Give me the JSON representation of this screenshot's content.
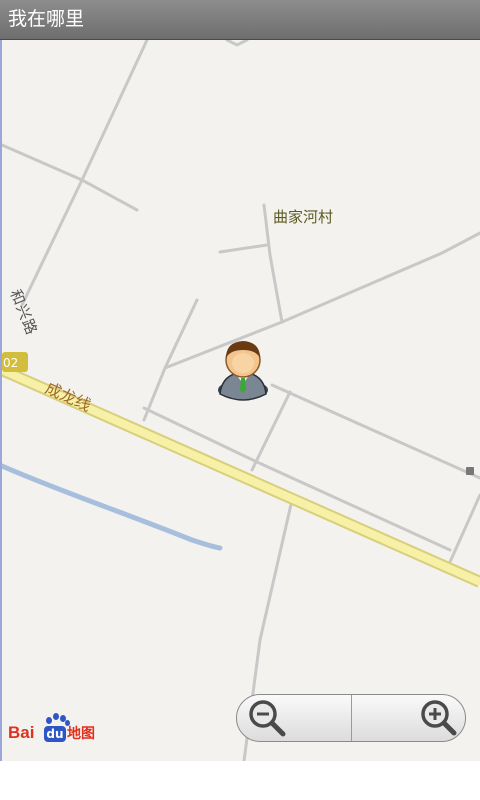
{
  "app": {
    "title": "我在哪里"
  },
  "map": {
    "labels": {
      "village": "曲家河村",
      "road_hexing": "和兴路",
      "road_chenglong": "成龙线",
      "road_shield": "02"
    },
    "icons": {
      "user_location": "person-marker-icon",
      "zoom_out": "zoom-out-magnifier-icon",
      "zoom_in": "zoom-in-magnifier-icon"
    },
    "colors": {
      "background": "#f4f2ef",
      "road_minor": "#c8c8c8",
      "road_major": "#f6f1a6",
      "road_major_border": "#d8cf7a",
      "water": "#a7bfdd",
      "shield": "#d2be3c",
      "label_village": "#5b5b22",
      "label_road": "#a06a26"
    }
  },
  "logo": {
    "brand": "Bai",
    "du": "du",
    "suffix": "地图"
  }
}
